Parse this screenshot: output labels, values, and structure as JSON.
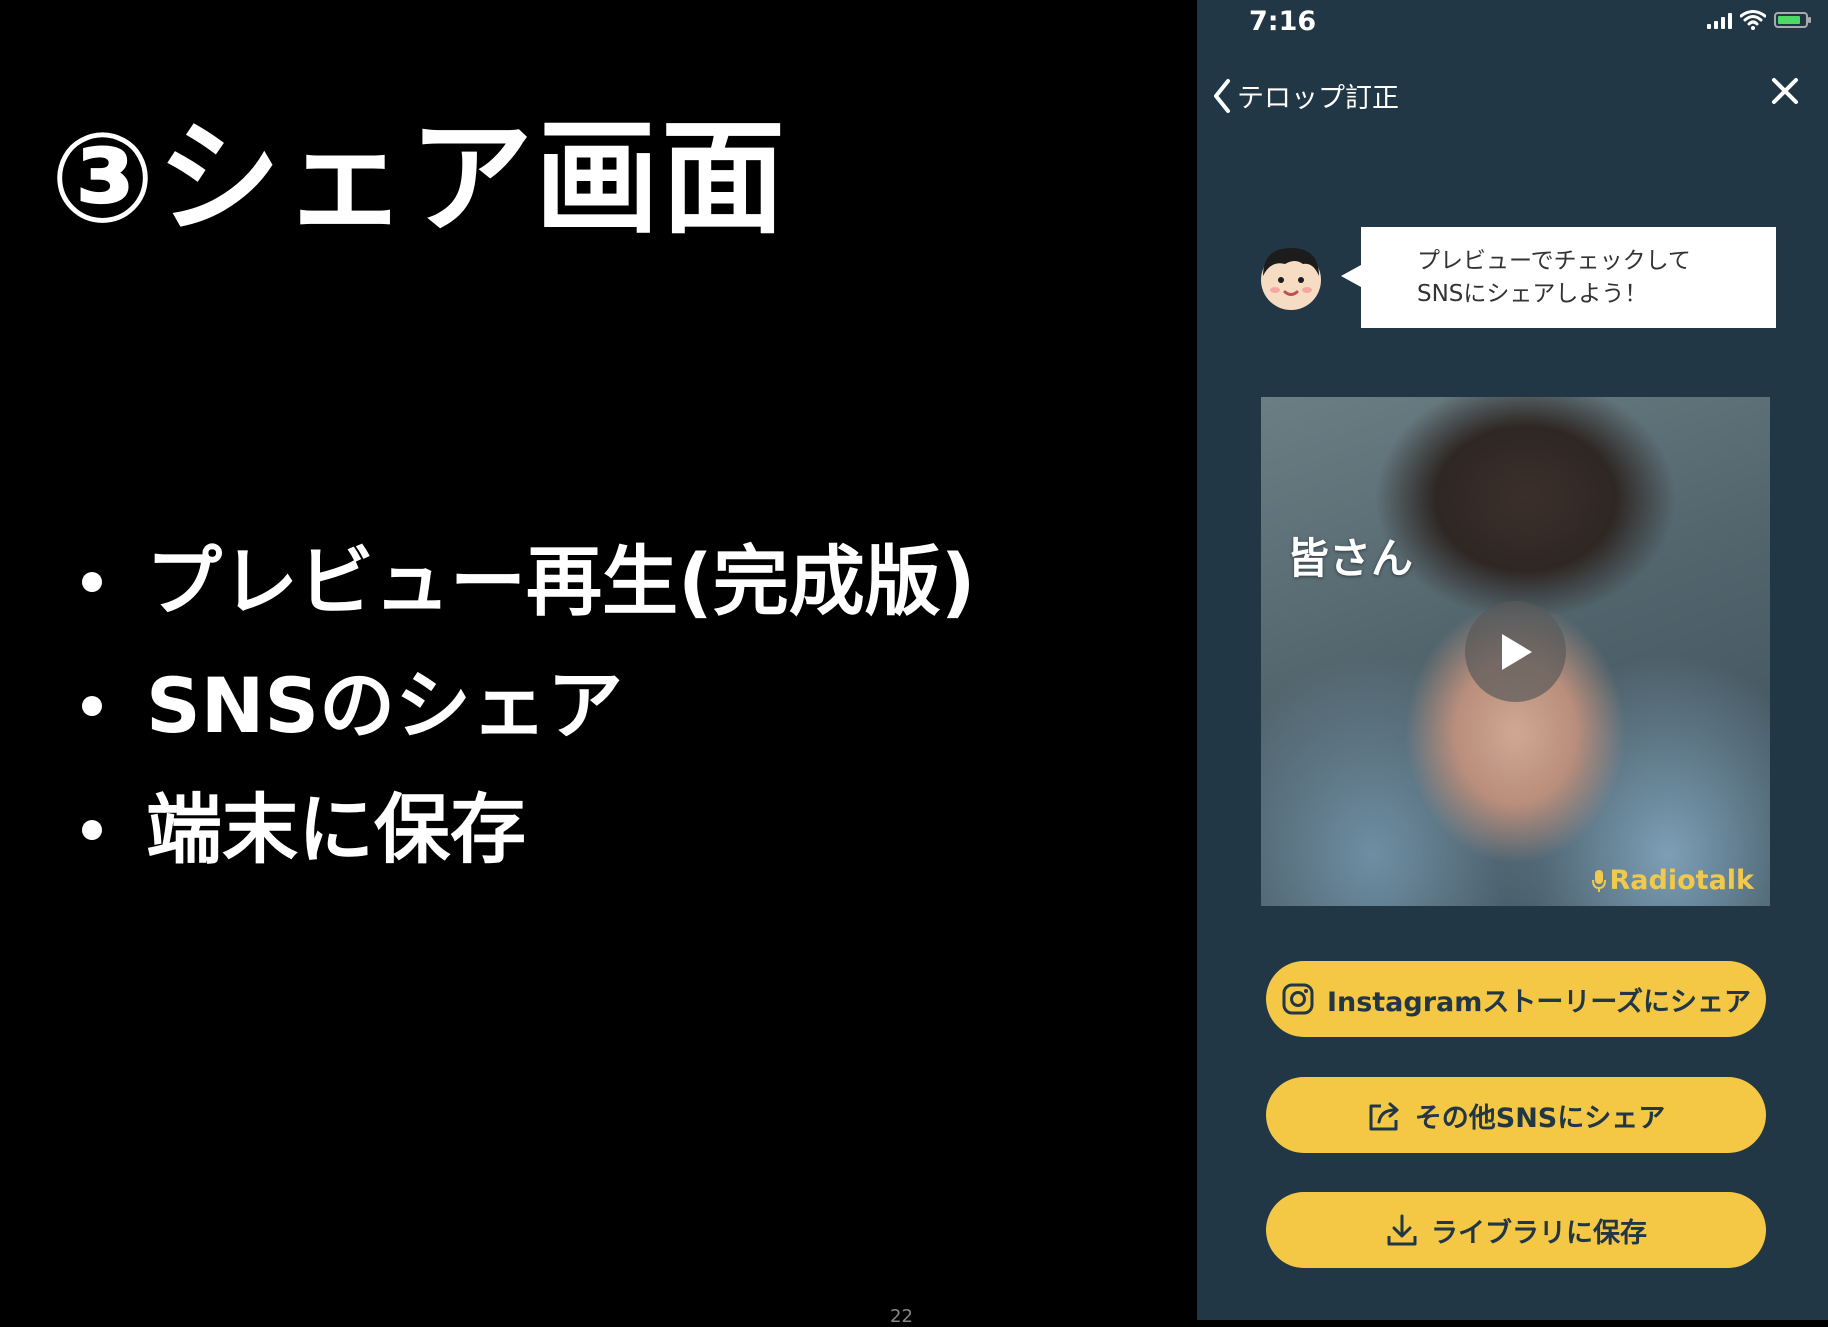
{
  "slide": {
    "title": "③シェア画面",
    "bullets": [
      "プレビュー再生(完成版)",
      "SNSのシェア",
      "端末に保存"
    ],
    "page_number": "22"
  },
  "phone": {
    "status": {
      "time": "7:16"
    },
    "nav": {
      "back_label": "テロップ訂正"
    },
    "speech": {
      "line1": "プレビューでチェックして",
      "line2": "SNSにシェアしよう！"
    },
    "preview": {
      "caption": "皆さん",
      "watermark": "Radiotalk"
    },
    "buttons": {
      "instagram": "Instagramストーリーズにシェア",
      "other_sns": "その他SNSにシェア",
      "save": "ライブラリに保存"
    },
    "colors": {
      "background": "#223745",
      "button": "#f4c844",
      "button_text": "#223745",
      "watermark": "#f1c94d"
    }
  }
}
